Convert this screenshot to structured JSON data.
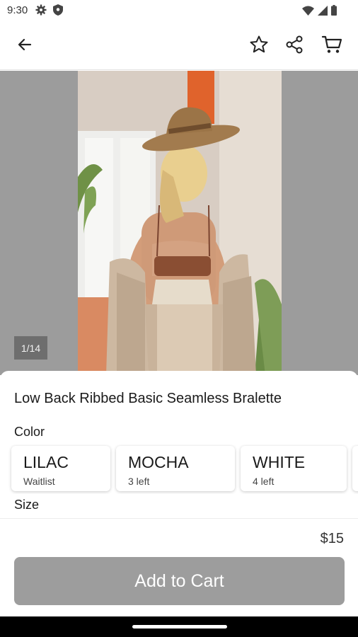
{
  "status_bar": {
    "time": "9:30",
    "left_icons": [
      "settings-gear-icon",
      "shield-icon"
    ],
    "right_icons": [
      "wifi-icon",
      "cell-signal-icon",
      "battery-icon"
    ]
  },
  "app_bar": {
    "icons": [
      "back-arrow-icon",
      "star-icon",
      "share-icon",
      "cart-icon"
    ]
  },
  "gallery": {
    "counter": "1/14"
  },
  "product": {
    "title": "Low Back Ribbed Basic Seamless Bralette",
    "color_label": "Color",
    "colors": [
      {
        "name": "LILAC",
        "stock": "Waitlist"
      },
      {
        "name": "MOCHA",
        "stock": "3 left"
      },
      {
        "name": "WHITE",
        "stock": "4 left"
      }
    ],
    "size_label": "Size",
    "price": "$15",
    "add_to_cart_label": "Add to Cart"
  },
  "colors": {
    "button_disabled": "#9d9d9d",
    "gallery_bg": "#9c9c9c"
  }
}
